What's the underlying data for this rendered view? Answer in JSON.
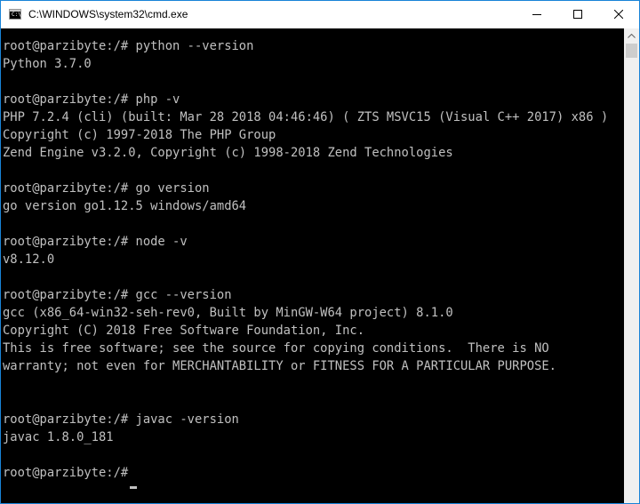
{
  "window": {
    "title": "C:\\WINDOWS\\system32\\cmd.exe",
    "icon_text": "C:\\"
  },
  "console": {
    "lines": [
      "",
      "root@parzibyte:/# python --version",
      "Python 3.7.0",
      "",
      "root@parzibyte:/# php -v",
      "PHP 7.2.4 (cli) (built: Mar 28 2018 04:46:46) ( ZTS MSVC15 (Visual C++ 2017) x86 )",
      "Copyright (c) 1997-2018 The PHP Group",
      "Zend Engine v3.2.0, Copyright (c) 1998-2018 Zend Technologies",
      "",
      "root@parzibyte:/# go version",
      "go version go1.12.5 windows/amd64",
      "",
      "root@parzibyte:/# node -v",
      "v8.12.0",
      "",
      "root@parzibyte:/# gcc --version",
      "gcc (x86_64-win32-seh-rev0, Built by MinGW-W64 project) 8.1.0",
      "Copyright (C) 2018 Free Software Foundation, Inc.",
      "This is free software; see the source for copying conditions.  There is NO",
      "warranty; not even for MERCHANTABILITY or FITNESS FOR A PARTICULAR PURPOSE.",
      "",
      "",
      "root@parzibyte:/# javac -version",
      "javac 1.8.0_181",
      "",
      "root@parzibyte:/# "
    ]
  },
  "colors": {
    "console_background": "#000000",
    "console_text": "#c0c0c0",
    "titlebar_background": "#ffffff",
    "window_border": "#1883d7",
    "scrollbar_track": "#f0f0f0",
    "scrollbar_thumb": "#cdcdcd"
  },
  "icons": {
    "app": "cmd-app-icon",
    "minimize": "minimize-icon",
    "maximize": "maximize-icon",
    "close": "close-icon",
    "scroll_up": "chevron-up-icon"
  }
}
